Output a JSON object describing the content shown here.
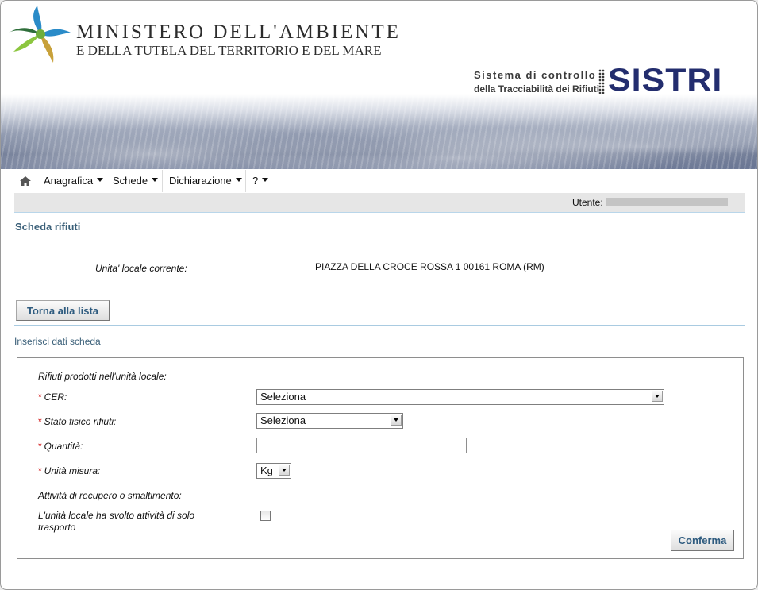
{
  "header": {
    "ministry_title": "MINISTERO DELL'AMBIENTE",
    "ministry_subtitle": "E DELLA TUTELA DEL TERRITORIO E DEL MARE",
    "system_line1": "Sistema di controllo",
    "system_line2": "della Tracciabilità dei Rifiuti",
    "system_logo": "SISTRI",
    "logo_colors": [
      "#2a8bc8",
      "#8cc63f",
      "#c8a13a",
      "#2e6e3a"
    ]
  },
  "nav": {
    "home_icon": "home-icon",
    "items": [
      {
        "label": "Anagrafica"
      },
      {
        "label": "Schede"
      },
      {
        "label": "Dichiarazione"
      },
      {
        "label": "?"
      }
    ]
  },
  "user": {
    "label": "Utente:",
    "value_redacted": true
  },
  "page": {
    "title": "Scheda rifiuti",
    "unit_label": "Unita' locale corrente:",
    "unit_value": "PIAZZA DELLA CROCE ROSSA 1 00161 ROMA (RM)",
    "back_button": "Torna alla lista",
    "section_title": "Inserisci dati scheda"
  },
  "form": {
    "group_title": "Rifiuti prodotti nell'unità locale:",
    "required_marker": "*",
    "cer_label": "CER:",
    "cer_value": "Seleziona",
    "stato_label": "Stato fisico rifiuti:",
    "stato_value": "Seleziona",
    "quantita_label": "Quantità:",
    "quantita_value": "",
    "unita_label": "Unità misura:",
    "unita_value": "Kg",
    "attivita_label": "Attività di recupero o smaltimento:",
    "trasporto_label_line1": "L'unità locale ha svolto attività di solo",
    "trasporto_label_line2": "trasporto",
    "trasporto_checked": false,
    "confirm_button": "Conferma"
  },
  "colors": {
    "accent": "#3b6079",
    "required": "#cc0000",
    "sistri_blue": "#232d6e",
    "divider": "#a9cbe1"
  }
}
